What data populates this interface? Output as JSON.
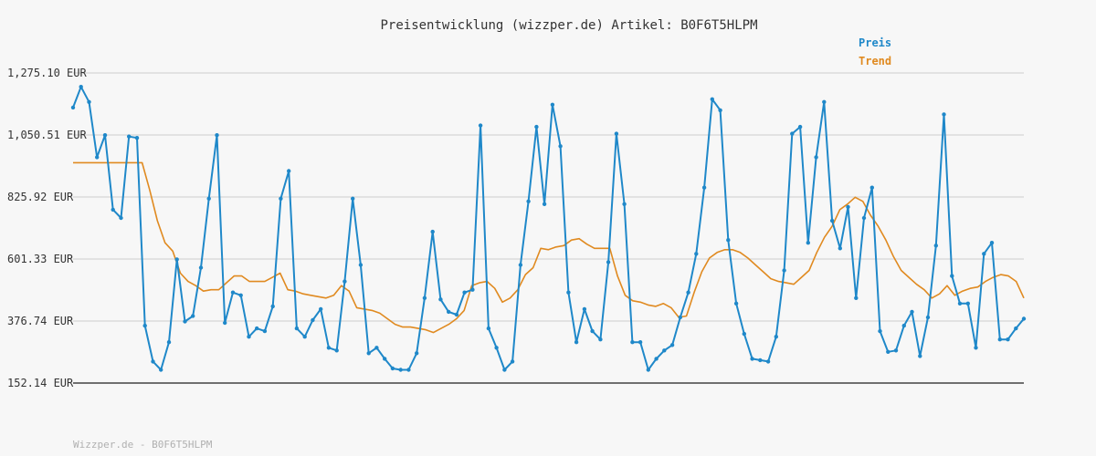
{
  "chart_data": {
    "type": "line",
    "title": "Preisentwicklung (wizzper.de) Artikel: B0F6T5HLPM",
    "footer": "Wizzper.de - B0F6T5HLPM",
    "ylim": [
      152.14,
      1275.1
    ],
    "yticks": [
      "1,275.10 EUR",
      "1,050.51 EUR",
      "825.92 EUR",
      "601.33 EUR",
      "376.74 EUR",
      "152.14 EUR"
    ],
    "yticks_values": [
      1275.1,
      1050.51,
      825.92,
      601.33,
      376.74,
      152.14
    ],
    "grid": true,
    "legend_position": "top-right",
    "series": [
      {
        "name": "Preis",
        "color": "#1f88c9",
        "markers": true,
        "values": [
          1150,
          1225,
          1170,
          970,
          1050,
          780,
          750,
          1045,
          1040,
          360,
          230,
          200,
          300,
          600,
          375,
          395,
          570,
          820,
          1050,
          370,
          480,
          470,
          320,
          350,
          340,
          430,
          820,
          920,
          350,
          320,
          380,
          420,
          280,
          270,
          520,
          820,
          580,
          260,
          280,
          240,
          205,
          200,
          200,
          260,
          460,
          700,
          455,
          410,
          400,
          480,
          490,
          1085,
          350,
          280,
          200,
          230,
          580,
          810,
          1080,
          800,
          1160,
          1010,
          480,
          300,
          420,
          340,
          310,
          590,
          1055,
          800,
          300,
          300,
          200,
          240,
          270,
          290,
          390,
          480,
          620,
          860,
          1180,
          1140,
          670,
          440,
          330,
          240,
          235,
          230,
          320,
          560,
          1055,
          1080,
          660,
          970,
          1170,
          740,
          640,
          790,
          460,
          750,
          860,
          340,
          265,
          270,
          360,
          410,
          250,
          390,
          650,
          1125,
          540,
          440,
          440,
          280,
          620,
          660,
          310,
          310,
          350,
          385
        ]
      },
      {
        "name": "Trend",
        "color": "#e08a20",
        "markers": false,
        "values": [
          950,
          950,
          950,
          950,
          950,
          950,
          950,
          950,
          950,
          950,
          850,
          740,
          660,
          630,
          550,
          520,
          505,
          485,
          490,
          490,
          515,
          540,
          540,
          520,
          520,
          520,
          535,
          550,
          490,
          485,
          475,
          470,
          465,
          460,
          470,
          505,
          485,
          425,
          420,
          415,
          405,
          385,
          365,
          355,
          355,
          350,
          345,
          335,
          350,
          365,
          385,
          415,
          505,
          515,
          520,
          495,
          445,
          460,
          490,
          545,
          570,
          640,
          635,
          645,
          650,
          670,
          675,
          655,
          640,
          640,
          640,
          540,
          470,
          450,
          445,
          435,
          430,
          440,
          425,
          390,
          395,
          480,
          555,
          605,
          625,
          635,
          635,
          625,
          605,
          580,
          555,
          530,
          520,
          515,
          510,
          535,
          560,
          625,
          680,
          720,
          780,
          800,
          825,
          810,
          760,
          720,
          670,
          610,
          560,
          535,
          510,
          490,
          460,
          475,
          505,
          470,
          485,
          495,
          500,
          520,
          535,
          545,
          540,
          520,
          460
        ]
      }
    ]
  }
}
